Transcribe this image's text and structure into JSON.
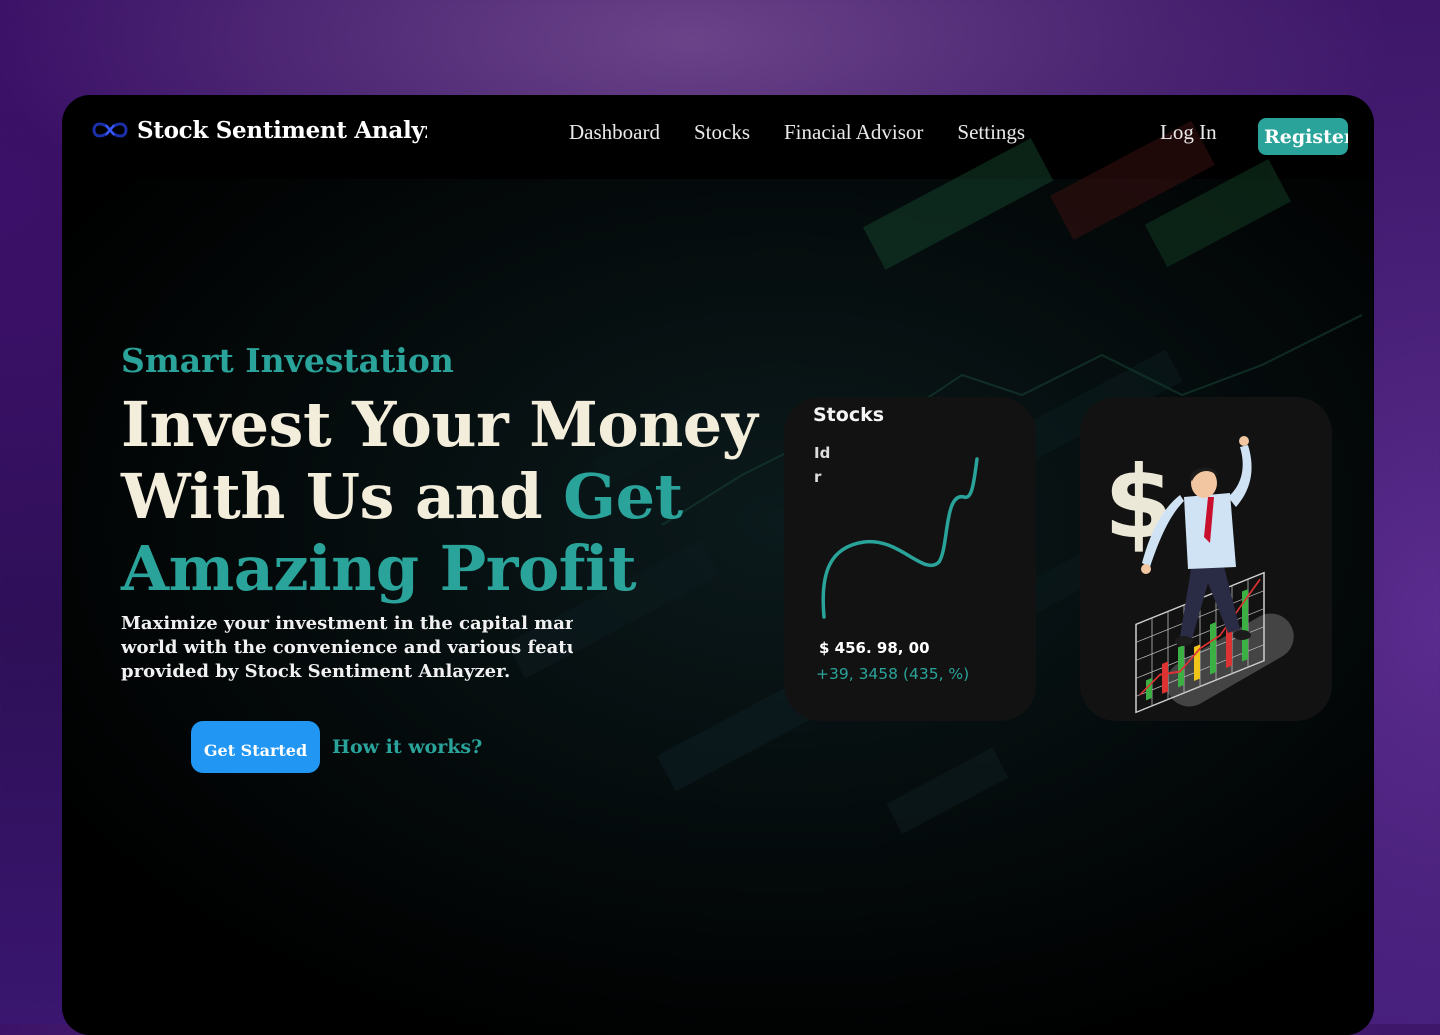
{
  "brand": {
    "name": "Stock Sentiment Analyzer"
  },
  "nav": {
    "links": [
      "Dashboard",
      "Stocks",
      "Finacial Advisor",
      "Settings"
    ],
    "login": "Log In",
    "register": "Register"
  },
  "hero": {
    "eyebrow": "Smart Investation",
    "headline_line1": "Invest Your Money",
    "headline_line2_white": "With Us and ",
    "headline_line2_accent": "Get",
    "headline_line3": "Amazing Profit",
    "description_lines": [
      "Maximize your investment in the capital market",
      "world with the convenience and various features",
      "provided by Stock Sentiment Anlayzer."
    ],
    "cta_primary": "Get Started",
    "cta_secondary": "How it works?"
  },
  "stock_card": {
    "title": "Stocks",
    "sub_lines": [
      "Id",
      "r"
    ],
    "price": "$ 456. 98, 00",
    "change": "+39, 3458 (435, %)"
  },
  "illustration": {
    "symbol": "$"
  },
  "colors": {
    "accent": "#2aa39a",
    "primary_button": "#2196f3",
    "headline": "#f3eedc"
  },
  "icons": {
    "logo": "infinity-logo-icon"
  }
}
